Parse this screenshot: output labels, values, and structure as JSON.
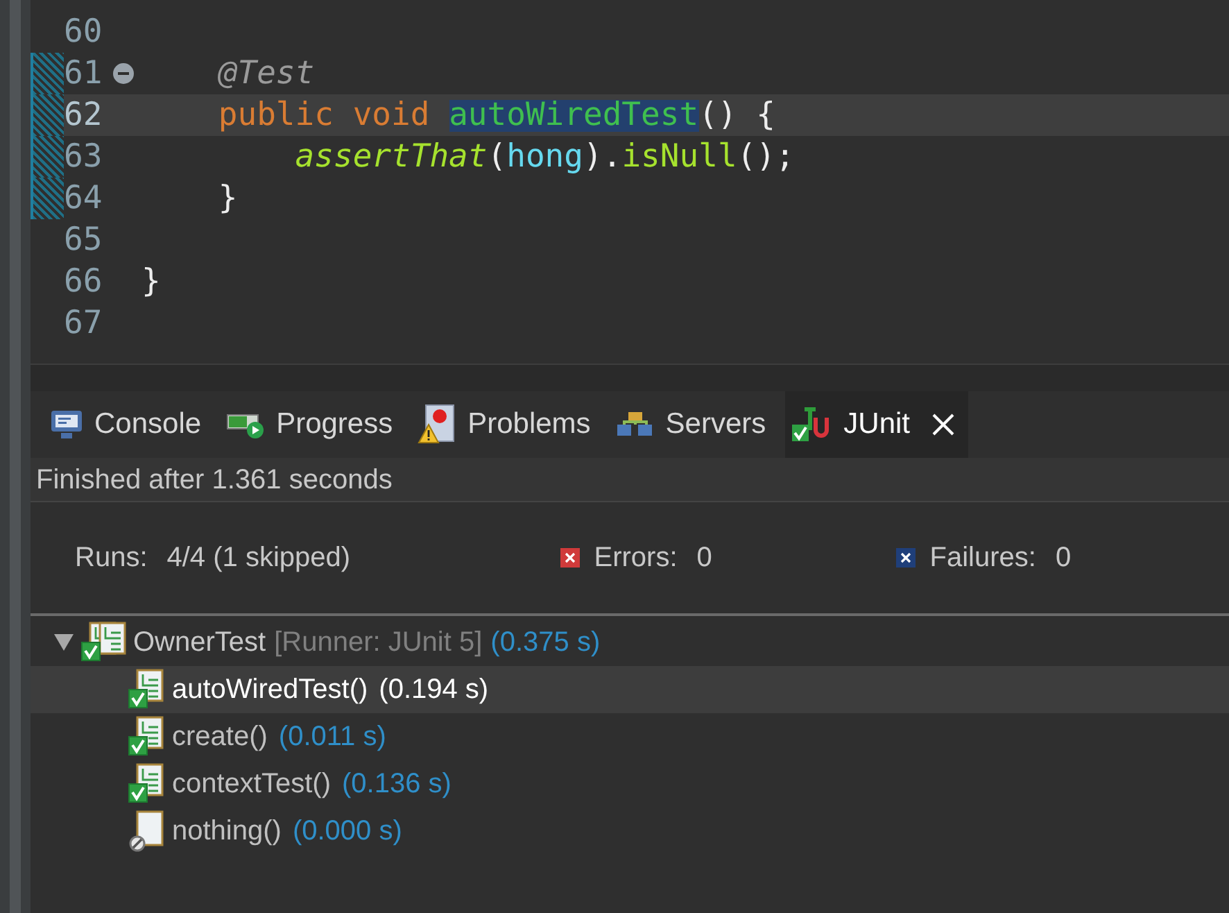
{
  "editor": {
    "lines": [
      {
        "number": "60",
        "changed": false,
        "current": false
      },
      {
        "number": "61",
        "changed": true,
        "current": false,
        "fold": {
          "expanded": true
        },
        "tokens": [
          {
            "kind": "annotation",
            "text": "    @Test"
          }
        ]
      },
      {
        "number": "62",
        "changed": true,
        "current": true,
        "tokens": [
          {
            "kind": "keyword",
            "text": "    public void "
          },
          {
            "kind": "declaration",
            "text": "autoWiredTest",
            "selected": true
          },
          {
            "kind": "plain",
            "text": "() {"
          }
        ]
      },
      {
        "number": "63",
        "changed": true,
        "current": false,
        "tokens": [
          {
            "kind": "static",
            "text": "        assertThat"
          },
          {
            "kind": "plain",
            "text": "("
          },
          {
            "kind": "field",
            "text": "hong"
          },
          {
            "kind": "plain",
            "text": ")."
          },
          {
            "kind": "method",
            "text": "isNull"
          },
          {
            "kind": "plain",
            "text": "();"
          }
        ]
      },
      {
        "number": "64",
        "changed": true,
        "current": false,
        "tokens": [
          {
            "kind": "plain",
            "text": "    }"
          }
        ]
      },
      {
        "number": "65",
        "changed": false,
        "current": false
      },
      {
        "number": "66",
        "changed": false,
        "current": false,
        "tokens": [
          {
            "kind": "plain",
            "text": "}"
          }
        ]
      },
      {
        "number": "67",
        "changed": false,
        "current": false
      }
    ]
  },
  "tabs": [
    {
      "kind": "console",
      "label": "Console",
      "selected": false
    },
    {
      "kind": "progress",
      "label": "Progress",
      "selected": false
    },
    {
      "kind": "problems",
      "label": "Problems",
      "selected": false
    },
    {
      "kind": "servers",
      "label": "Servers",
      "selected": false
    },
    {
      "kind": "junit",
      "label": "JUnit",
      "selected": true
    }
  ],
  "status": "Finished after 1.361 seconds",
  "summary": {
    "runs_label": "Runs:",
    "runs": "4/4 (1 skipped)",
    "errors_label": "Errors:",
    "errors": "0",
    "failures_label": "Failures:",
    "failures": "0"
  },
  "tree": {
    "name": "OwnerTest",
    "runner": "[Runner: JUnit 5]",
    "time": "(0.375 s)",
    "expanded": true,
    "children": [
      {
        "name": "autoWiredTest()",
        "time": "(0.194 s)",
        "kind": "passed",
        "selected": true
      },
      {
        "name": "create()",
        "time": "(0.011 s)",
        "kind": "passed",
        "selected": false
      },
      {
        "name": "contextTest()",
        "time": "(0.136 s)",
        "kind": "passed",
        "selected": false
      },
      {
        "name": "nothing()",
        "time": "(0.000 s)",
        "kind": "skipped",
        "selected": false
      }
    ]
  }
}
